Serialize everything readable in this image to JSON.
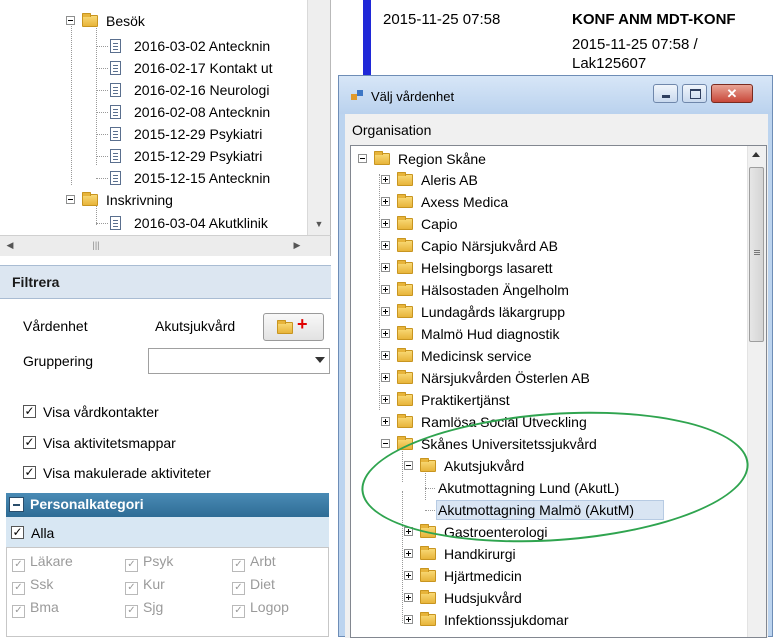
{
  "left_tree": {
    "items": [
      {
        "label": "Besök",
        "type": "folder"
      },
      {
        "label": "2016-03-02 Antecknin",
        "type": "doc"
      },
      {
        "label": "2016-02-17 Kontakt ut",
        "type": "doc"
      },
      {
        "label": "2016-02-16 Neurologi",
        "type": "doc"
      },
      {
        "label": "2016-02-08 Antecknin",
        "type": "doc"
      },
      {
        "label": "2015-12-29 Psykiatri",
        "type": "doc"
      },
      {
        "label": "2015-12-29 Psykiatri",
        "type": "doc"
      },
      {
        "label": "2015-12-15 Antecknin",
        "type": "doc"
      },
      {
        "label": "Inskrivning",
        "type": "folder"
      },
      {
        "label": "2016-03-04 Akutklinik",
        "type": "doc"
      }
    ]
  },
  "filter": {
    "title": "Filtrera",
    "vardenhet_label": "Vårdenhet",
    "vardenhet_value": "Akutsjukvård",
    "add_unit_icon": "folder-add-icon",
    "gruppering_label": "Gruppering",
    "gruppering_value": "",
    "checkboxes": [
      {
        "label": "Visa vårdkontakter",
        "checked": true
      },
      {
        "label": "Visa aktivitetsmappar",
        "checked": true
      },
      {
        "label": "Visa makulerade aktiviteter",
        "checked": true
      }
    ]
  },
  "staff": {
    "title": "Personalkategori",
    "all_label": "Alla",
    "all_checked": true,
    "categories": [
      [
        "Läkare",
        "Psyk",
        "Arbt"
      ],
      [
        "Ssk",
        "Kur",
        "Diet"
      ],
      [
        "Bma",
        "Sjg",
        "Logop"
      ]
    ]
  },
  "background_doc": {
    "date": "2015-11-25 07:58",
    "title": "KONF ANM MDT-KONF",
    "sub1": "2015-11-25 07:58 /",
    "sub2": "Lak125607",
    "bar_color": "#1f28d8"
  },
  "dialog": {
    "title": "Välj vårdenhet",
    "close_label": "✕",
    "org_label": "Organisation",
    "tree": [
      {
        "label": "Region Skåne",
        "level": 0,
        "expander": "minus"
      },
      {
        "label": "Aleris AB",
        "level": 1,
        "expander": "plus"
      },
      {
        "label": "Axess Medica",
        "level": 1,
        "expander": "plus"
      },
      {
        "label": "Capio",
        "level": 1,
        "expander": "plus"
      },
      {
        "label": "Capio Närsjukvård AB",
        "level": 1,
        "expander": "plus"
      },
      {
        "label": "Helsingborgs lasarett",
        "level": 1,
        "expander": "plus"
      },
      {
        "label": "Hälsostaden Ängelholm",
        "level": 1,
        "expander": "plus"
      },
      {
        "label": "Lundagårds läkargrupp",
        "level": 1,
        "expander": "plus"
      },
      {
        "label": "Malmö Hud diagnostik",
        "level": 1,
        "expander": "plus"
      },
      {
        "label": "Medicinsk service",
        "level": 1,
        "expander": "plus"
      },
      {
        "label": "Närsjukvården Österlen AB",
        "level": 1,
        "expander": "plus"
      },
      {
        "label": "Praktikertjänst",
        "level": 1,
        "expander": "plus"
      },
      {
        "label": "Ramlösa Social Utveckling",
        "level": 1,
        "expander": "plus"
      },
      {
        "label": "Skånes Universitetssjukvård",
        "level": 1,
        "expander": "minus"
      },
      {
        "label": "Akutsjukvård",
        "level": 2,
        "expander": "minus"
      },
      {
        "label": "Akutmottagning Lund (AkutL)",
        "level": 3,
        "expander": "none"
      },
      {
        "label": "Akutmottagning Malmö (AkutM)",
        "level": 3,
        "expander": "none",
        "selected": true
      },
      {
        "label": "Gastroenterologi",
        "level": 2,
        "expander": "plus"
      },
      {
        "label": "Handkirurgi",
        "level": 2,
        "expander": "plus"
      },
      {
        "label": "Hjärtmedicin",
        "level": 2,
        "expander": "plus"
      },
      {
        "label": "Hudsjukvård",
        "level": 2,
        "expander": "plus"
      },
      {
        "label": "Infektionssjukdomar",
        "level": 2,
        "expander": "plus"
      }
    ]
  },
  "colors": {
    "annotation": "#2fa44f",
    "staff_header": "#2e6c95",
    "selection": "#d9e5f3"
  }
}
